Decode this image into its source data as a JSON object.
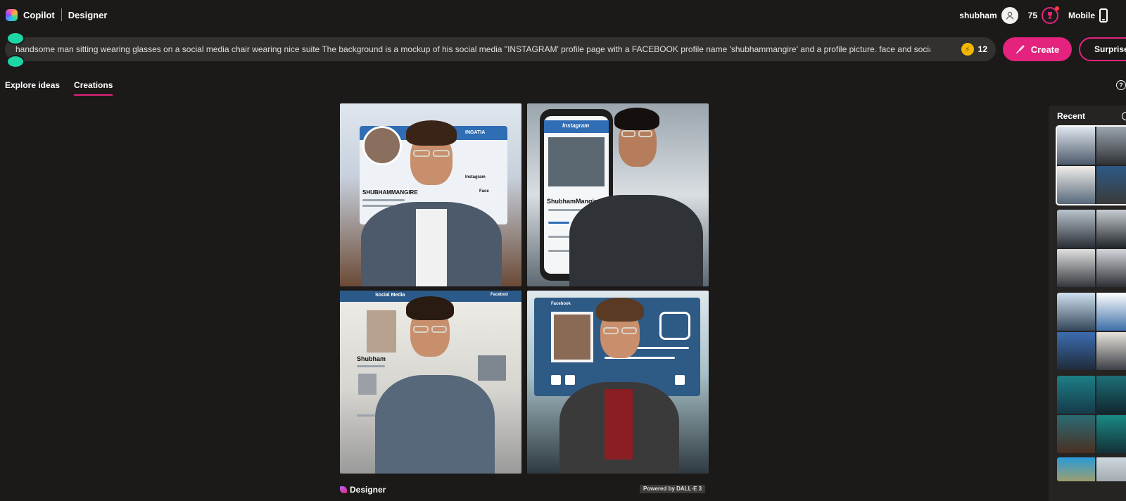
{
  "header": {
    "brand": "Copilot",
    "product": "Designer",
    "username": "shubham",
    "points": "75",
    "mobile_label": "Mobile",
    "icons": [
      "copilot-logo-icon",
      "user-avatar-icon",
      "rewards-trophy-icon",
      "mobile-phone-icon"
    ]
  },
  "prompt": {
    "text": "handsome man sitting wearing glasses on a social media chair wearing nice suite The background is a mockup of his social media \"INSTAGRAM' profile page with a FACEBOOK profile name 'shubhammangire' and a profile picture. face and social media na",
    "boosts": "12",
    "create_label": "Create",
    "surprise_label": "Surprise Me"
  },
  "tabs": [
    {
      "label": "Explore ideas",
      "active": false
    },
    {
      "label": "Creations",
      "active": true
    }
  ],
  "gallery": {
    "tiles": [
      {
        "name": "generated-image-1",
        "visible_text": [
          "SHUBHAMMANGIRE",
          "INGATIA",
          "Instagram",
          "Face"
        ]
      },
      {
        "name": "generated-image-2",
        "visible_text": [
          "Instagram",
          "ShubhamMangir"
        ]
      },
      {
        "name": "generated-image-3",
        "visible_text": [
          "Social Media",
          "Facebod",
          "Shubham"
        ]
      },
      {
        "name": "generated-image-4",
        "visible_text": [
          "Facebook"
        ]
      }
    ],
    "footer_brand": "Designer",
    "powered_by": "Powered by DALL·E 3"
  },
  "recent": {
    "title": "Recent",
    "groups": 5
  },
  "colors": {
    "background": "#1b1a19",
    "prompt_bg": "#323130",
    "accent": "#e3237e",
    "knob": "#1ed6a5",
    "panel": "#252423"
  }
}
